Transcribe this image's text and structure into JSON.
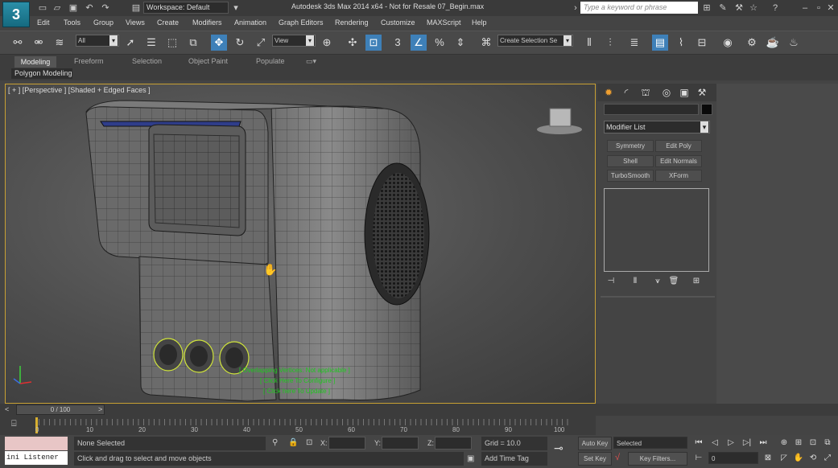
{
  "window": {
    "title": "Autodesk 3ds Max  2014 x64  - Not for Resale   07_Begin.max",
    "workspace": "Workspace: Default",
    "search_placeholder": "Type a keyword or phrase"
  },
  "menus": [
    "Edit",
    "Tools",
    "Group",
    "Views",
    "Create",
    "Modifiers",
    "Animation",
    "Graph Editors",
    "Rendering",
    "Customize",
    "MAXScript",
    "Help"
  ],
  "toolbar": {
    "selection_filter": "All",
    "ref_coord": "View",
    "named_selection": "Create Selection Se",
    "snap_labels": [
      "3",
      "%"
    ]
  },
  "ribbon": {
    "tabs": [
      "Modeling",
      "Freeform",
      "Selection",
      "Object Paint",
      "Populate"
    ],
    "panel": "Polygon Modeling"
  },
  "viewport": {
    "label": "[ + ] [Perspective ] [Shaded + Edged Faces ]",
    "overlay": [
      "[ Overlapping Vertices: Not applicable ]",
      "[ Click Here To Configure ]",
      "[ Click here To Update ]"
    ],
    "viewcube": "LEFT FRONT"
  },
  "command_panel": {
    "modifier_list": "Modifier List",
    "buttons": [
      "Symmetry",
      "Edit Poly",
      "Shell",
      "Edit Normals",
      "TurboSmooth",
      "XForm"
    ]
  },
  "timeline": {
    "slider": "0 / 100",
    "ticks": [
      "0",
      "10",
      "20",
      "30",
      "40",
      "50",
      "60",
      "70",
      "80",
      "90",
      "100"
    ]
  },
  "status": {
    "listener": "ini Listener",
    "selection": "None Selected",
    "prompt": "Click and drag to select and move objects",
    "x_label": "X:",
    "y_label": "Y:",
    "z_label": "Z:",
    "grid": "Grid = 10.0",
    "add_time_tag": "Add Time Tag",
    "auto_key": "Auto Key",
    "set_key": "Set Key",
    "key_mode": "Selected",
    "key_filters": "Key Filters...",
    "frame": "0"
  },
  "colors": {
    "accent": "#3e80b8",
    "viewport_border": "#c8a033",
    "overlay_text": "#1ec81e"
  }
}
